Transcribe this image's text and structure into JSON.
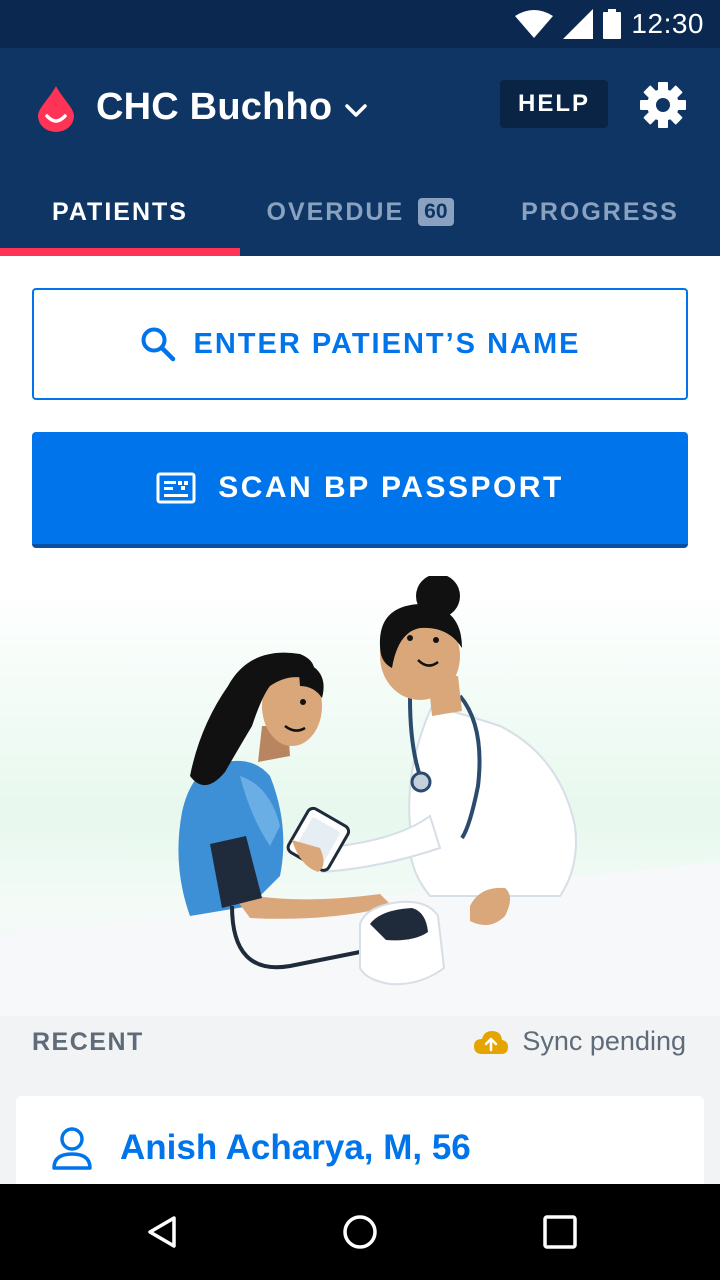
{
  "status_bar": {
    "time": "12:30",
    "icons": [
      "wifi-icon",
      "signal-icon",
      "battery-icon"
    ]
  },
  "app_bar": {
    "facility_name": "CHC Buchho",
    "help_label": "HELP"
  },
  "tabs": [
    {
      "label": "PATIENTS",
      "active": true
    },
    {
      "label": "OVERDUE",
      "badge": "60",
      "active": false
    },
    {
      "label": "PROGRESS",
      "active": false
    }
  ],
  "search": {
    "placeholder": "ENTER PATIENT’S NAME"
  },
  "scan_button": {
    "label": "SCAN BP PASSPORT"
  },
  "recent": {
    "label": "RECENT",
    "sync_status": "Sync pending",
    "patients": [
      {
        "name": "Anish Acharya, M, 56"
      }
    ]
  },
  "colors": {
    "primary_dark": "#0e3564",
    "accent_blue": "#0075eb",
    "tab_indicator": "#ff3355",
    "sync_icon": "#e6a400"
  }
}
